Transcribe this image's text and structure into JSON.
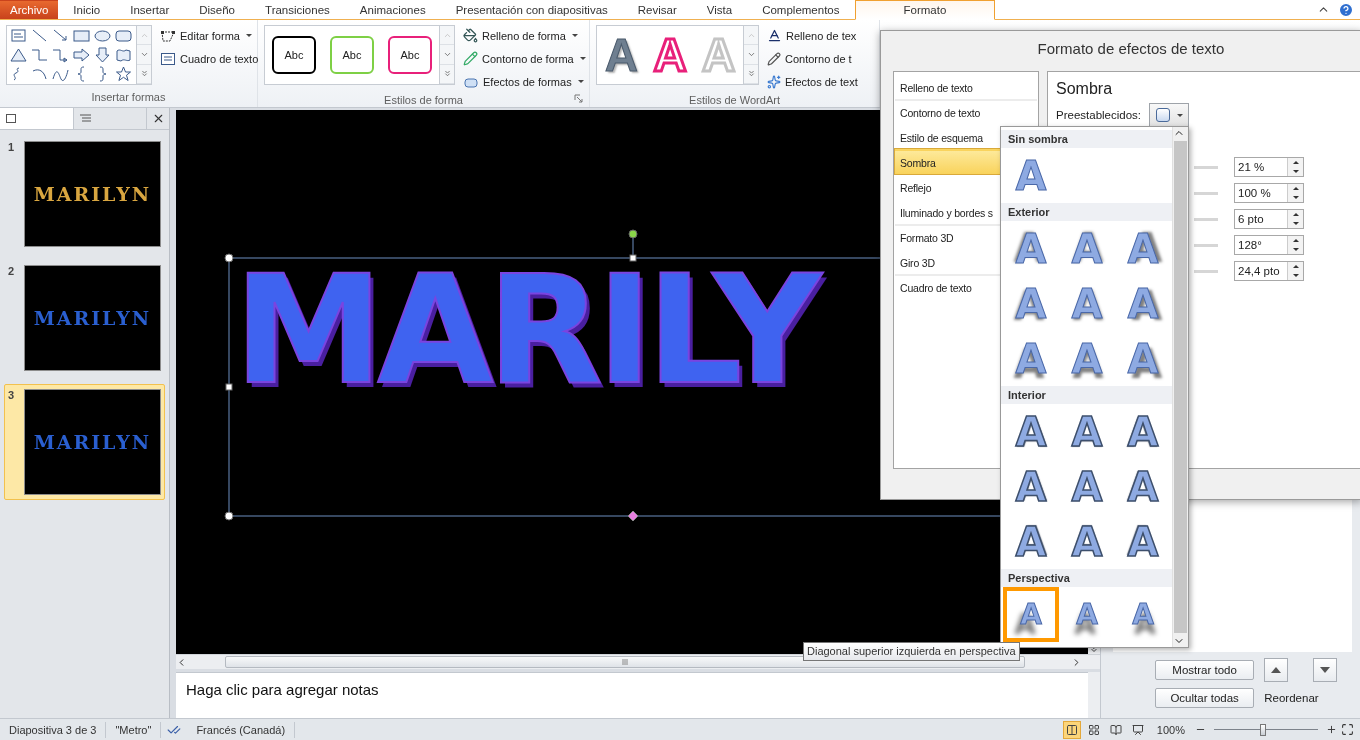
{
  "tabs": [
    {
      "label": "Archivo",
      "kind": "file",
      "selected": false
    },
    {
      "label": "Inicio",
      "kind": "tab",
      "selected": false
    },
    {
      "label": "Insertar",
      "kind": "tab",
      "selected": false
    },
    {
      "label": "Diseño",
      "kind": "tab",
      "selected": false
    },
    {
      "label": "Transiciones",
      "kind": "tab",
      "selected": false
    },
    {
      "label": "Animaciones",
      "kind": "tab",
      "selected": false
    },
    {
      "label": "Presentación con diapositivas",
      "kind": "tab",
      "selected": false
    },
    {
      "label": "Revisar",
      "kind": "tab",
      "selected": false
    },
    {
      "label": "Vista",
      "kind": "tab",
      "selected": false
    },
    {
      "label": "Complementos",
      "kind": "tab",
      "selected": false
    },
    {
      "label": "Formato",
      "kind": "tab",
      "selected": true
    }
  ],
  "ribbon": {
    "insert_shapes": {
      "label": "Insertar formas",
      "buttons": [
        {
          "label": "Editar forma",
          "dropdown": true
        },
        {
          "label": "Cuadro de texto",
          "dropdown": false
        }
      ]
    },
    "shape_styles": {
      "label": "Estilos de forma",
      "presets": [
        {
          "text": "Abc",
          "color": "#000000"
        },
        {
          "text": "Abc",
          "color": "#7ed045"
        },
        {
          "text": "Abc",
          "color": "#e8207a"
        }
      ],
      "buttons": [
        {
          "label": "Relleno de forma",
          "dropdown": true
        },
        {
          "label": "Contorno de forma",
          "dropdown": true
        },
        {
          "label": "Efectos de formas",
          "dropdown": true
        }
      ]
    },
    "wordart_styles": {
      "label": "Estilos de WordArt",
      "presets": [
        {
          "glyph": "A",
          "kind": "filled"
        },
        {
          "glyph": "A",
          "kind": "pink-outline"
        },
        {
          "glyph": "A",
          "kind": "gray-outline"
        }
      ],
      "buttons": [
        {
          "label": "Relleno de tex",
          "dropdown": false
        },
        {
          "label": "Contorno de t",
          "dropdown": false
        },
        {
          "label": "Efectos de text",
          "dropdown": false
        }
      ]
    }
  },
  "slides_panel": {
    "thumbnails": [
      {
        "number": "1",
        "text": "MARILYN",
        "color": "#d9a640",
        "selected": false
      },
      {
        "number": "2",
        "text": "MARILYN",
        "color": "#2a5fd0",
        "selected": false
      },
      {
        "number": "3",
        "text": "MARILYN",
        "color": "#2a5fd0",
        "selected": true
      }
    ]
  },
  "slide": {
    "wordart": "MARILY"
  },
  "notes": {
    "placeholder": "Haga clic para agregar notas"
  },
  "selection_pane": {
    "buttons": [
      "Mostrar todo",
      "Ocultar todas"
    ],
    "reorder_label": "Reordenar"
  },
  "dialog": {
    "title": "Formato de efectos de texto",
    "categories": [
      {
        "label": "Relleno de texto",
        "selected": false,
        "divider": false
      },
      {
        "label": "Contorno de texto",
        "selected": false,
        "divider": true
      },
      {
        "label": "Estilo de esquema",
        "selected": false,
        "divider": false
      },
      {
        "label": "Sombra",
        "selected": true,
        "divider": false
      },
      {
        "label": "Reflejo",
        "selected": false,
        "divider": false
      },
      {
        "label": "Iluminado y bordes s",
        "selected": false,
        "divider": false
      },
      {
        "label": "Formato 3D",
        "selected": false,
        "divider": true
      },
      {
        "label": "Giro 3D",
        "selected": false,
        "divider": false
      },
      {
        "label": "Cuadro de texto",
        "selected": false,
        "divider": true
      }
    ],
    "section_title": "Sombra",
    "presets_label": "Preestablecidos:",
    "fields": [
      "21 %",
      "100 %",
      "6 pto",
      "128°",
      "24,4 pto"
    ]
  },
  "gallery": {
    "sections": [
      {
        "title": "Sin sombra",
        "kind": "none",
        "items": [
          {
            "glyph": "A",
            "selected": false
          }
        ]
      },
      {
        "title": "Exterior",
        "kind": "outer",
        "items": [
          {
            "glyph": "A",
            "selected": false
          },
          {
            "glyph": "A",
            "selected": false
          },
          {
            "glyph": "A",
            "selected": false
          },
          {
            "glyph": "A",
            "selected": false
          },
          {
            "glyph": "A",
            "selected": false
          },
          {
            "glyph": "A",
            "selected": false
          },
          {
            "glyph": "A",
            "selected": false
          },
          {
            "glyph": "A",
            "selected": false
          },
          {
            "glyph": "A",
            "selected": false
          }
        ]
      },
      {
        "title": "Interior",
        "kind": "inner",
        "items": [
          {
            "glyph": "A",
            "selected": false
          },
          {
            "glyph": "A",
            "selected": false
          },
          {
            "glyph": "A",
            "selected": false
          },
          {
            "glyph": "A",
            "selected": false
          },
          {
            "glyph": "A",
            "selected": false
          },
          {
            "glyph": "A",
            "selected": false
          },
          {
            "glyph": "A",
            "selected": false
          },
          {
            "glyph": "A",
            "selected": false
          },
          {
            "glyph": "A",
            "selected": false
          }
        ]
      },
      {
        "title": "Perspectiva",
        "kind": "perspective",
        "items": [
          {
            "glyph": "A",
            "selected": true
          },
          {
            "glyph": "A",
            "selected": false
          },
          {
            "glyph": "A",
            "selected": false
          }
        ]
      }
    ]
  },
  "tooltip": "Diagonal superior izquierda en perspectiva",
  "status_bar": {
    "slide": "Diapositiva 3 de 3",
    "theme": "\"Metro\"",
    "language": "Francés (Canadá)",
    "views": [
      {
        "selected": true
      },
      {
        "selected": false
      },
      {
        "selected": false
      },
      {
        "selected": false
      }
    ],
    "zoom": "100%",
    "zoom_slider": {
      "level": 0.47
    }
  }
}
